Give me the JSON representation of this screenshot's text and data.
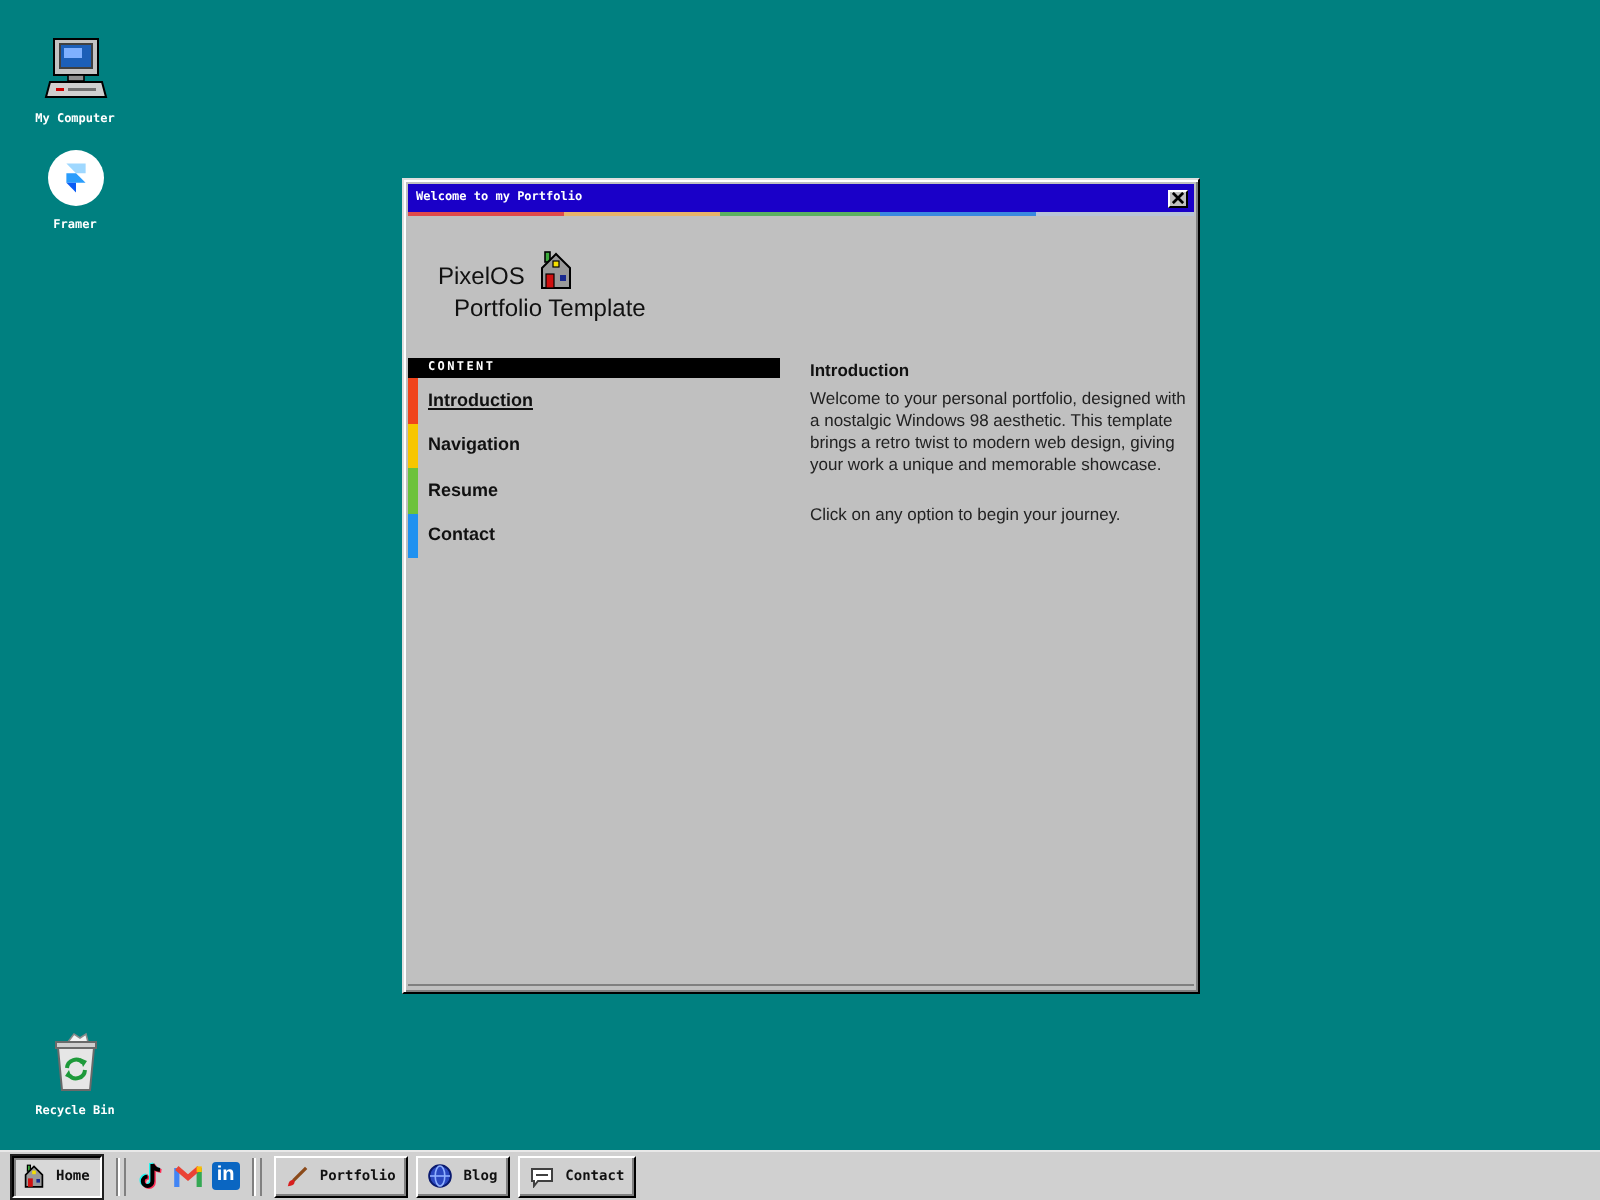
{
  "desktop_icons": [
    {
      "kind": "computer",
      "label": "My Computer"
    },
    {
      "kind": "framer",
      "label": "Framer"
    },
    {
      "kind": "recycle_bin",
      "label": "Recycle Bin"
    }
  ],
  "window": {
    "title": "Welcome to my Portfolio",
    "heading": "PixelOS",
    "subheading": "Portfolio Template",
    "sidebar": {
      "header": "CONTENT",
      "items": [
        {
          "label": "Introduction",
          "selected": true,
          "color": "#f0441c"
        },
        {
          "label": "Navigation",
          "selected": false,
          "color": "#f7c600"
        },
        {
          "label": "Resume",
          "selected": false,
          "color": "#6cc23c"
        },
        {
          "label": "Contact",
          "selected": false,
          "color": "#2091f0"
        }
      ]
    },
    "content": {
      "title": "Introduction",
      "paragraphs": [
        "Welcome to your personal portfolio, designed with a nostalgic Windows 98 aesthetic. This template brings a retro twist to modern web design, giving your work a unique and memorable showcase.",
        "Click on any option to begin your journey."
      ]
    }
  },
  "taskbar": {
    "pinned": [
      {
        "kind": "house",
        "label": "Home",
        "selected": true
      }
    ],
    "social_links": [
      {
        "kind": "tiktok"
      },
      {
        "kind": "gmail"
      },
      {
        "kind": "linkedin",
        "text": "in"
      }
    ],
    "windows": [
      {
        "kind": "brush",
        "label": "Portfolio",
        "selected": false
      },
      {
        "kind": "globe",
        "label": "Blog",
        "selected": false
      },
      {
        "kind": "chat",
        "label": "Contact",
        "selected": false
      }
    ]
  }
}
